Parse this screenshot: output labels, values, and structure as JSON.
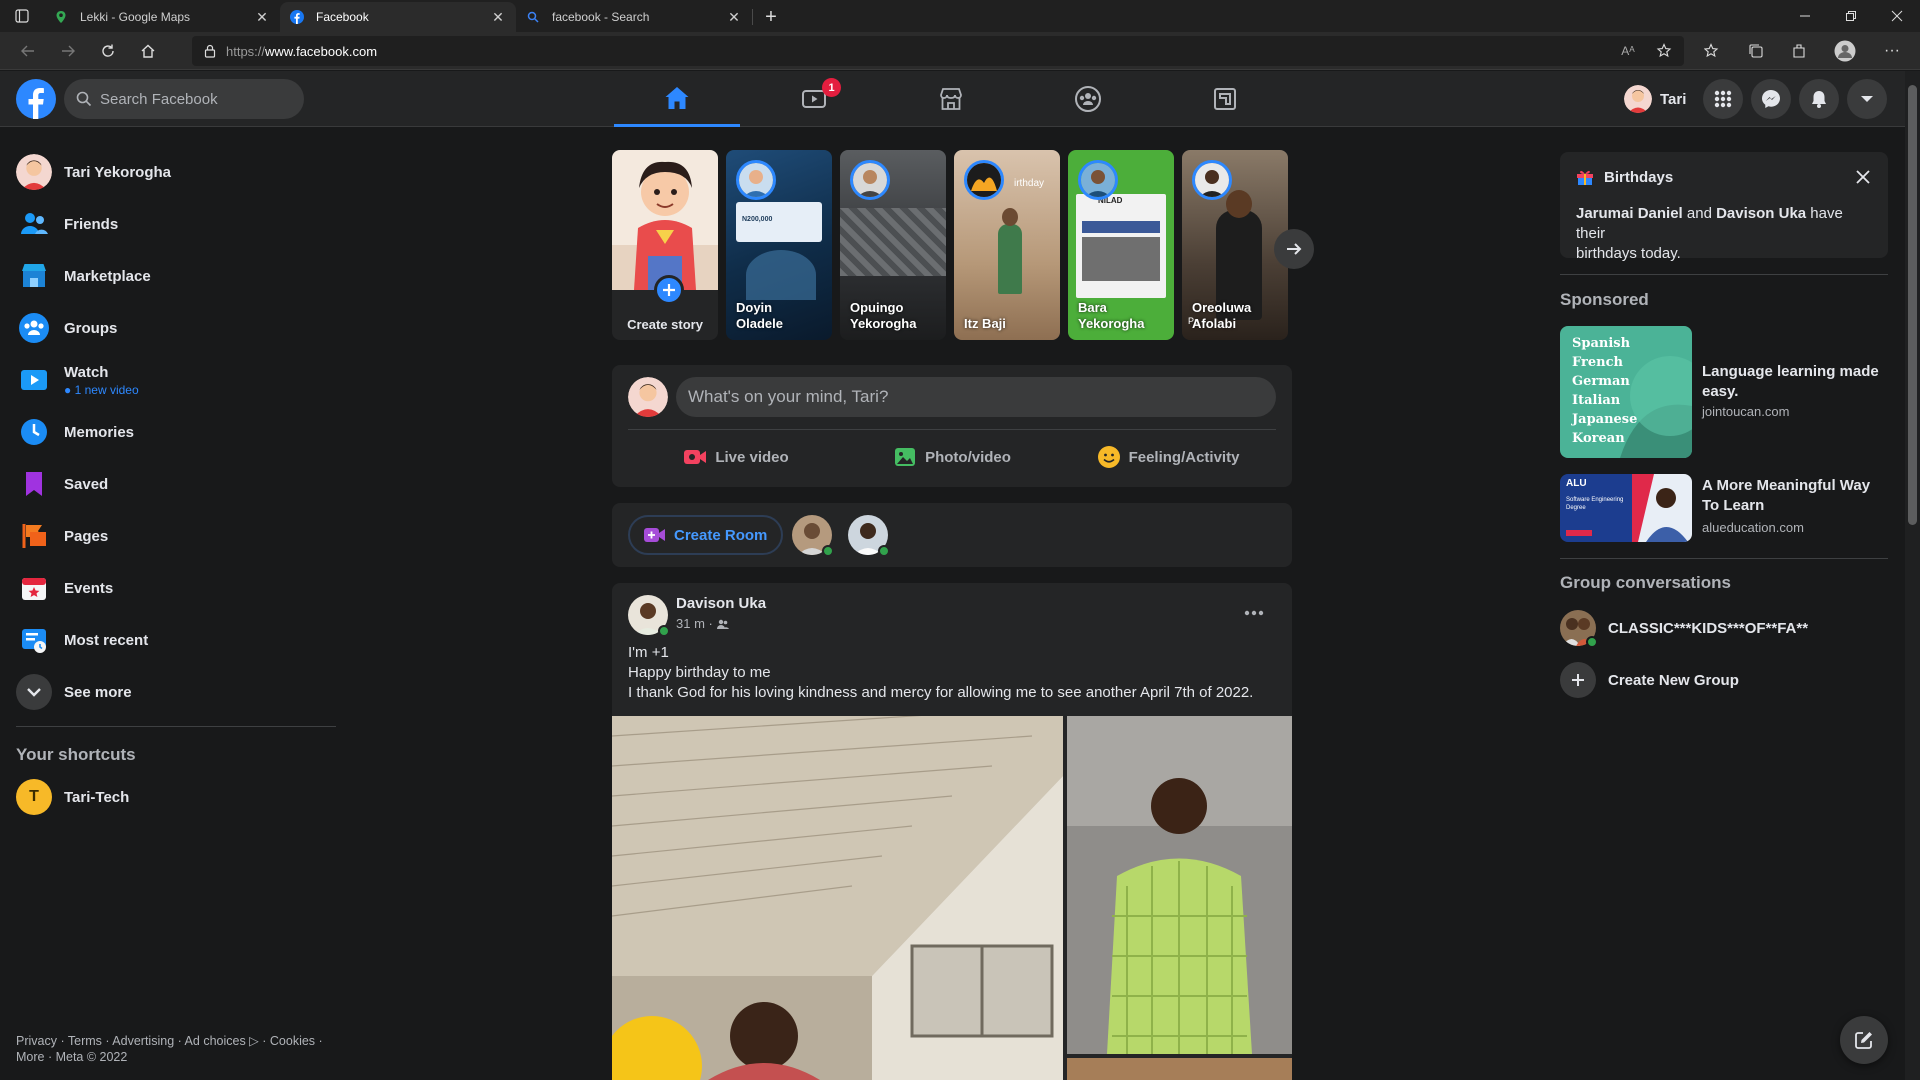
{
  "browser": {
    "tabs": [
      {
        "title": "Lekki - Google Maps",
        "active": false
      },
      {
        "title": "Facebook",
        "active": true
      },
      {
        "title": "facebook - Search",
        "active": false
      }
    ],
    "url_scheme": "https://",
    "url_host": "www.facebook.com",
    "reader_icon_text": "Aᴬ"
  },
  "header": {
    "search_placeholder": "Search Facebook",
    "watch_badge": "1",
    "profile_name": "Tari",
    "accent": "#2d88ff"
  },
  "sidebar": {
    "items": [
      {
        "label": "Tari Yekorogha",
        "icon": "profile-avatar"
      },
      {
        "label": "Friends",
        "icon": "friends-icon"
      },
      {
        "label": "Marketplace",
        "icon": "marketplace-icon"
      },
      {
        "label": "Groups",
        "icon": "groups-icon"
      },
      {
        "label": "Watch",
        "icon": "watch-icon",
        "sub": "1 new video"
      },
      {
        "label": "Memories",
        "icon": "memories-icon"
      },
      {
        "label": "Saved",
        "icon": "saved-icon"
      },
      {
        "label": "Pages",
        "icon": "pages-icon"
      },
      {
        "label": "Events",
        "icon": "events-icon"
      },
      {
        "label": "Most recent",
        "icon": "most-recent-icon"
      },
      {
        "label": "See more",
        "icon": "chevron-down-icon"
      }
    ],
    "shortcuts_heading": "Your shortcuts",
    "shortcuts": [
      {
        "label": "Tari-Tech",
        "initial": "T"
      }
    ],
    "footer_line1": "Privacy · Terms · Advertising · Ad choices ▷ · Cookies ·",
    "footer_line2": "More · Meta © 2022"
  },
  "stories": [
    {
      "name": "Create story"
    },
    {
      "name_1": "Doyin",
      "name_2": "Oladele"
    },
    {
      "name_1": "Opuingo",
      "name_2": "Yekorogha"
    },
    {
      "name_1": "Itz Baji",
      "name_2": ""
    },
    {
      "name_1": "Bara",
      "name_2": "Yekorogha"
    },
    {
      "name_1": "Oreoluwa",
      "name_2": "Afolabi"
    }
  ],
  "story_text": {
    "price": "N200,000",
    "birthday": "irthday",
    "nilad": "NILAD",
    "pa": "Pa"
  },
  "composer": {
    "placeholder": "What's on your mind, Tari?",
    "live": "Live video",
    "photo": "Photo/video",
    "feeling": "Feeling/Activity"
  },
  "rooms": {
    "create_label": "Create Room"
  },
  "post": {
    "author": "Davison Uka",
    "time": "31 m ·",
    "lines": [
      "I'm +1",
      "Happy birthday to me",
      "I thank God for his loving kindness and mercy for allowing me to see another April 7th of 2022."
    ]
  },
  "right": {
    "birthdays_title": "Birthdays",
    "birthday_name_1": "Jarumai Daniel",
    "birthday_and": " and ",
    "birthday_name_2": "Davison Uka",
    "birthday_rest": " have their",
    "birthday_line2": "birthdays today.",
    "sponsored": "Sponsored",
    "ads": [
      {
        "title": "Language learning made easy.",
        "domain": "jointoucan.com",
        "languages": [
          "Spanish",
          "French",
          "German",
          "Italian",
          "Japanese",
          "Korean"
        ]
      },
      {
        "title": "A More Meaningful Way To Learn",
        "domain": "alueducation.com",
        "brand": "ALU",
        "tagline": "Software Engineering Degree"
      }
    ],
    "group_heading": "Group conversations",
    "groups": [
      {
        "label": "CLASSIC***KIDS***OF**FA**"
      }
    ],
    "create_group": "Create New Group"
  }
}
